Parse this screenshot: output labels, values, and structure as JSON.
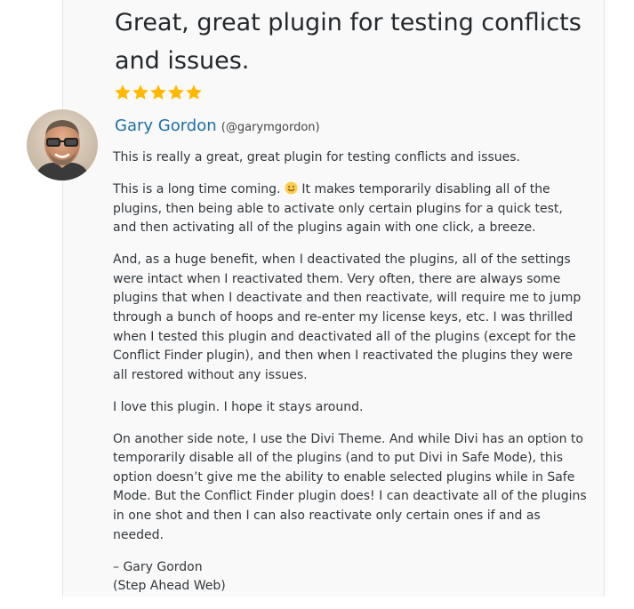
{
  "review": {
    "title": "Great, great plugin for testing conflicts and issues.",
    "rating": 5,
    "rating_max": 5,
    "colors": {
      "star": "#ffb900",
      "reviewer_link": "#1e6fa5",
      "text": "#32373c"
    },
    "reviewer": {
      "name": "Gary Gordon",
      "handle": "(@garymgordon)"
    },
    "paragraphs": {
      "p1": "This is really a great, great plugin for testing conflicts and issues.",
      "p2_before_emoji": "This is a long time coming. ",
      "p2_after_emoji": " It makes temporarily disabling all of the plugins, then being able to activate only certain plugins for a quick test, and then activating all of the plugins again with one click, a breeze.",
      "p3": "And, as a huge benefit, when I deactivated the plugins, all of the settings were intact when I reactivated them. Very often, there are always some plugins that when I deactivate and then reactivate, will require me to jump through a bunch of hoops and re-enter my license keys, etc. I was thrilled when I tested this plugin and deactivated all of the plugins (except for the Conflict Finder plugin), and then when I reactivated the plugins they were all restored without any issues.",
      "p4": "I love this plugin. I hope it stays around.",
      "p5": "On another side note, I use the Divi Theme. And while Divi has an option to temporarily disable all of the plugins (and to put Divi in Safe Mode), this option doesn’t give me the ability to enable selected plugins while in Safe Mode. But the Conflict Finder plugin does! I can deactivate all of the plugins in one shot and then I can also reactivate only certain ones if and as needed.",
      "signature_name": "– Gary Gordon",
      "signature_company": "(Step Ahead Web)"
    },
    "icons": {
      "star": "star-icon",
      "emoji": "smile-emoji-icon",
      "avatar": "reviewer-avatar-photo"
    }
  }
}
